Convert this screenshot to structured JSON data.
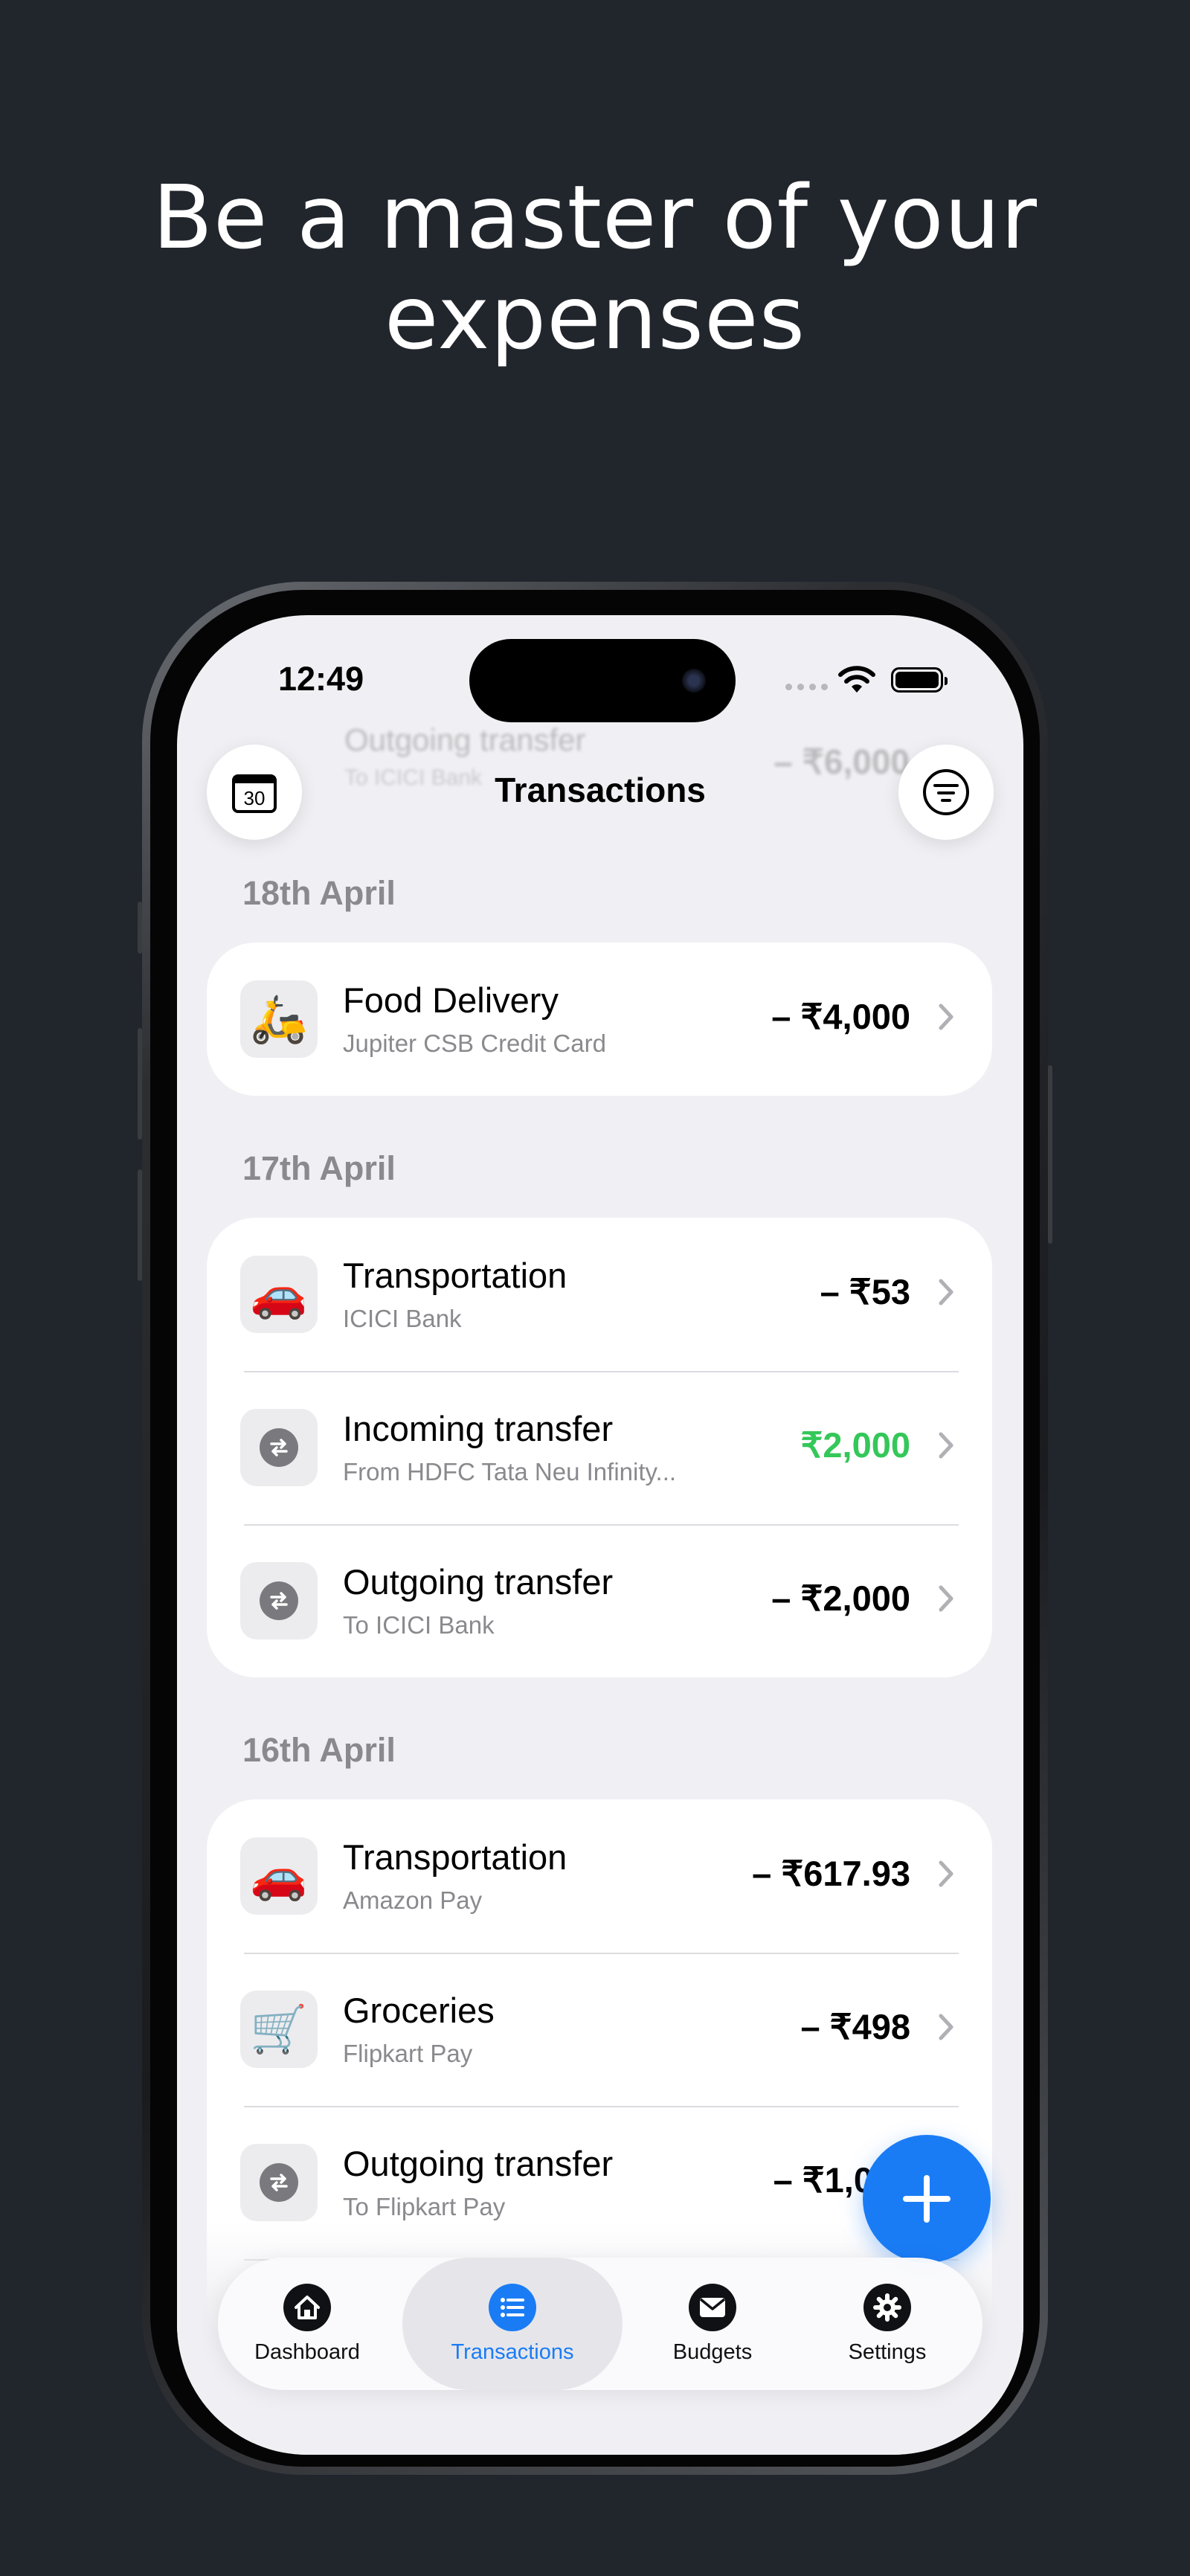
{
  "headline": {
    "line1": "Be a master of your",
    "line2": "expenses"
  },
  "status_bar": {
    "time": "12:49"
  },
  "ghost_row": {
    "title": "Outgoing transfer",
    "subtitle": "To ICICI Bank",
    "amount": "– ₹6,000"
  },
  "header": {
    "title": "Transactions",
    "calendar_day": "30"
  },
  "sections": [
    {
      "label": "18th April",
      "rows": [
        {
          "icon": "🛵",
          "icon_name": "scooter-icon",
          "title": "Food Delivery",
          "subtitle": "Jupiter CSB Credit Card",
          "amount": "– ₹4,000",
          "type": "out"
        }
      ]
    },
    {
      "label": "17th April",
      "rows": [
        {
          "icon": "🚗",
          "icon_name": "car-icon",
          "title": "Transportation",
          "subtitle": "ICICI Bank",
          "amount": "– ₹53",
          "type": "out"
        },
        {
          "icon": "transfer",
          "icon_name": "transfer-icon",
          "title": "Incoming transfer",
          "subtitle": "From HDFC Tata Neu Infinity...",
          "amount": "₹2,000",
          "type": "in"
        },
        {
          "icon": "transfer",
          "icon_name": "transfer-icon",
          "title": "Outgoing transfer",
          "subtitle": "To ICICI Bank",
          "amount": "– ₹2,000",
          "type": "out"
        }
      ]
    },
    {
      "label": "16th April",
      "rows": [
        {
          "icon": "🚗",
          "icon_name": "car-icon",
          "title": "Transportation",
          "subtitle": "Amazon Pay",
          "amount": "– ₹617.93",
          "type": "out"
        },
        {
          "icon": "🛒",
          "icon_name": "shopping-cart-icon",
          "title": "Groceries",
          "subtitle": "Flipkart Pay",
          "amount": "– ₹498",
          "type": "out"
        },
        {
          "icon": "transfer",
          "icon_name": "transfer-icon",
          "title": "Outgoing transfer",
          "subtitle": "To Flipkart Pay",
          "amount": "– ₹1,0",
          "type": "out"
        }
      ]
    }
  ],
  "tabbar": [
    {
      "label": "Dashboard",
      "icon": "house-icon",
      "active": false
    },
    {
      "label": "Transactions",
      "icon": "list-icon",
      "active": true
    },
    {
      "label": "Budgets",
      "icon": "envelope-icon",
      "active": false
    },
    {
      "label": "Settings",
      "icon": "gear-icon",
      "active": false
    }
  ],
  "colors": {
    "accent": "#1a7cf5",
    "income": "#34c759",
    "background": "#21252c",
    "screen": "#f0f0f4"
  }
}
